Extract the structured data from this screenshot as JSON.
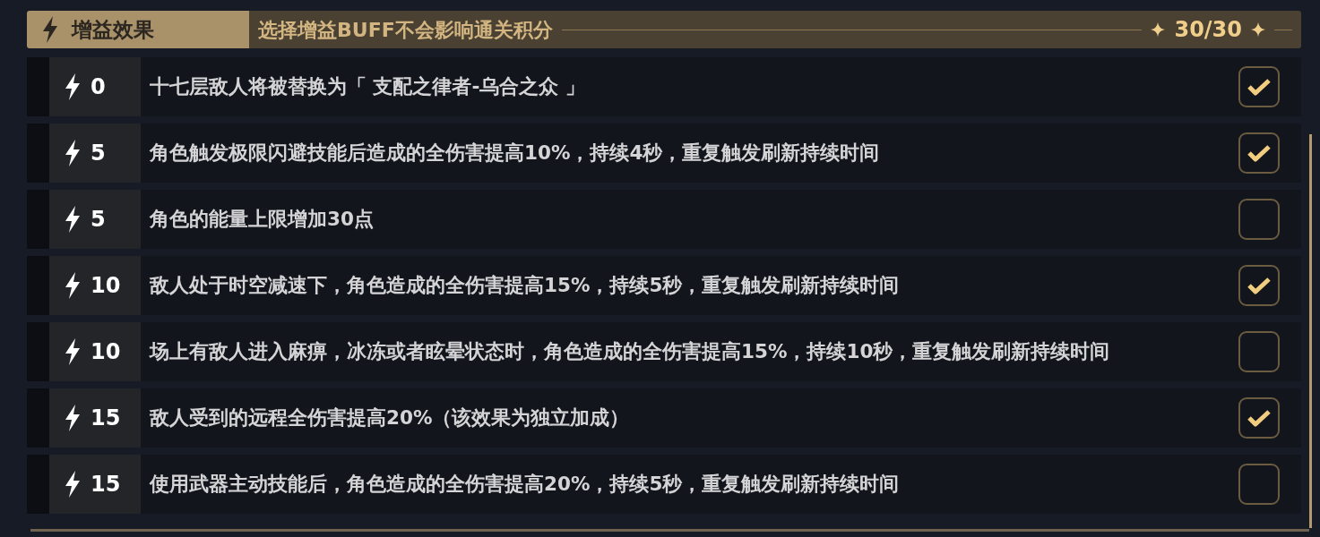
{
  "header": {
    "title": "增益效果",
    "subtitle": "选择增益BUFF不会影响通关积分",
    "score": "30/30"
  },
  "buffs": [
    {
      "cost": "0",
      "text": "十七层敌人将被替换为「 支配之律者-乌合之众 」",
      "checked": true
    },
    {
      "cost": "5",
      "text": "角色触发极限闪避技能后造成的全伤害提高10%，持续4秒，重复触发刷新持续时间",
      "checked": true
    },
    {
      "cost": "5",
      "text": "角色的能量上限增加30点",
      "checked": false
    },
    {
      "cost": "10",
      "text": "敌人处于时空减速下，角色造成的全伤害提高15%，持续5秒，重复触发刷新持续时间",
      "checked": true
    },
    {
      "cost": "10",
      "text": "场上有敌人进入麻痹，冰冻或者眩晕状态时，角色造成的全伤害提高15%，持续10秒，重复触发刷新持续时间",
      "checked": false
    },
    {
      "cost": "15",
      "text": "敌人受到的远程全伤害提高20%（该效果为独立加成）",
      "checked": true
    },
    {
      "cost": "15",
      "text": "使用武器主动技能后，角色造成的全伤害提高20%，持续5秒，重复触发刷新持续时间",
      "checked": false
    }
  ]
}
